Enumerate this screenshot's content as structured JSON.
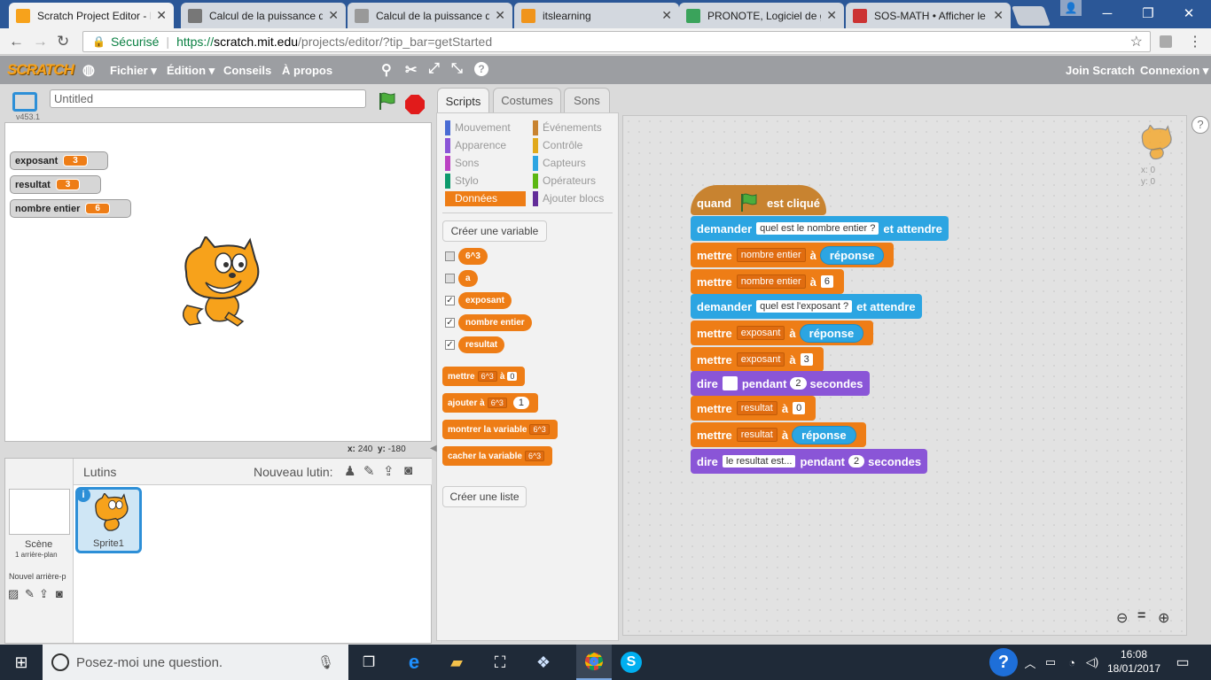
{
  "browser": {
    "tabs": [
      {
        "title": "Scratch Project Editor - I",
        "fav": "scratch-icon",
        "color": "#f7a21b",
        "active": true
      },
      {
        "title": "Calcul de la puissance d",
        "fav": "globe-icon",
        "color": "#777777"
      },
      {
        "title": "Calcul de la puissance d",
        "fav": "page-icon",
        "color": "#999999"
      },
      {
        "title": "itslearning",
        "fav": "its-icon",
        "color": "#f0941b"
      },
      {
        "title": "PRONOTE, Logiciel de g",
        "fav": "pronote-icon",
        "color": "#3aa35b"
      },
      {
        "title": "SOS-MATH • Afficher le",
        "fav": "sos-icon",
        "color": "#cc3333"
      }
    ],
    "secure_label": "Sécurisé",
    "url_prefix": "https://",
    "url_host": "scratch.mit.edu",
    "url_path": "/projects/editor/?tip_bar=getStarted"
  },
  "menu": {
    "logo": "SCRATCH",
    "items": [
      "Fichier ▾",
      "Édition ▾",
      "Conseils",
      "À propos"
    ],
    "join": "Join Scratch",
    "login": "Connexion ▾"
  },
  "stage": {
    "title": "Untitled",
    "version": "v453.1",
    "monitors": [
      {
        "name": "exposant",
        "value": "3"
      },
      {
        "name": "resultat",
        "value": "3"
      },
      {
        "name": "nombre entier",
        "value": "6"
      }
    ],
    "coords": {
      "x_label": "x:",
      "x": "240",
      "y_label": "y:",
      "y": "-180"
    }
  },
  "sprites": {
    "header": "Lutins",
    "new_sprite": "Nouveau lutin:",
    "scene": "Scène",
    "scene_sub": "1 arrière-plan",
    "new_bg": "Nouvel arrière-p",
    "sprite1": "Sprite1"
  },
  "tabs": [
    "Scripts",
    "Costumes",
    "Sons"
  ],
  "categories": {
    "left": [
      {
        "label": "Mouvement",
        "color": "#4a6cd4"
      },
      {
        "label": "Apparence",
        "color": "#8a55d7"
      },
      {
        "label": "Sons",
        "color": "#bb42c3"
      },
      {
        "label": "Stylo",
        "color": "#0e9a6c"
      },
      {
        "label": "Données",
        "color": "#ee7d16"
      }
    ],
    "right": [
      {
        "label": "Événements",
        "color": "#c88330"
      },
      {
        "label": "Contrôle",
        "color": "#e1a91a"
      },
      {
        "label": "Capteurs",
        "color": "#2ca5e2"
      },
      {
        "label": "Opérateurs",
        "color": "#5cb712"
      },
      {
        "label": "Ajouter blocs",
        "color": "#632d99"
      }
    ]
  },
  "palette": {
    "create_var": "Créer une variable",
    "vars": [
      {
        "name": "6^3",
        "checked": false
      },
      {
        "name": "a",
        "checked": false
      },
      {
        "name": "exposant",
        "checked": true
      },
      {
        "name": "nombre entier",
        "checked": true
      },
      {
        "name": "resultat",
        "checked": true
      }
    ],
    "check": "✓",
    "b1": {
      "t1": "mettre",
      "v": "6^3",
      "t2": "à",
      "n": "0"
    },
    "b2": {
      "t1": "ajouter",
      "t2": "à",
      "v": "6^3",
      "n": "1"
    },
    "b3": {
      "t1": "montrer la variable",
      "v": "6^3"
    },
    "b4": {
      "t1": "cacher la variable",
      "v": "6^3"
    },
    "create_list": "Créer une liste"
  },
  "script": {
    "hat": {
      "t1": "quand",
      "t2": "est cliqué"
    },
    "ask1": {
      "t1": "demander",
      "q": "quel est le nombre entier ?",
      "t2": "et attendre"
    },
    "set1": {
      "t1": "mettre",
      "v": "nombre entier",
      "t2": "à",
      "r": "réponse"
    },
    "set2": {
      "t1": "mettre",
      "v": "nombre entier",
      "t2": "à",
      "n": "6"
    },
    "ask2": {
      "t1": "demander",
      "q": "quel est l'exposant ?",
      "t2": "et attendre"
    },
    "set3": {
      "t1": "mettre",
      "v": "exposant",
      "t2": "à",
      "r": "réponse"
    },
    "set4": {
      "t1": "mettre",
      "v": "exposant",
      "t2": "à",
      "n": "3"
    },
    "say1": {
      "t1": "dire",
      "t2": "pendant",
      "n": "2",
      "t3": "secondes"
    },
    "set5": {
      "t1": "mettre",
      "v": "resultat",
      "t2": "à",
      "n": "0"
    },
    "set6": {
      "t1": "mettre",
      "v": "resultat",
      "t2": "à",
      "r": "réponse"
    },
    "say2": {
      "t1": "dire",
      "s": "le resultat est...",
      "t2": "pendant",
      "n": "2",
      "t3": "secondes"
    },
    "sprite_x": "x: 0",
    "sprite_y": "y: 0"
  },
  "taskbar": {
    "search": "Posez-moi une question.",
    "time": "16:08",
    "date": "18/01/2017"
  }
}
